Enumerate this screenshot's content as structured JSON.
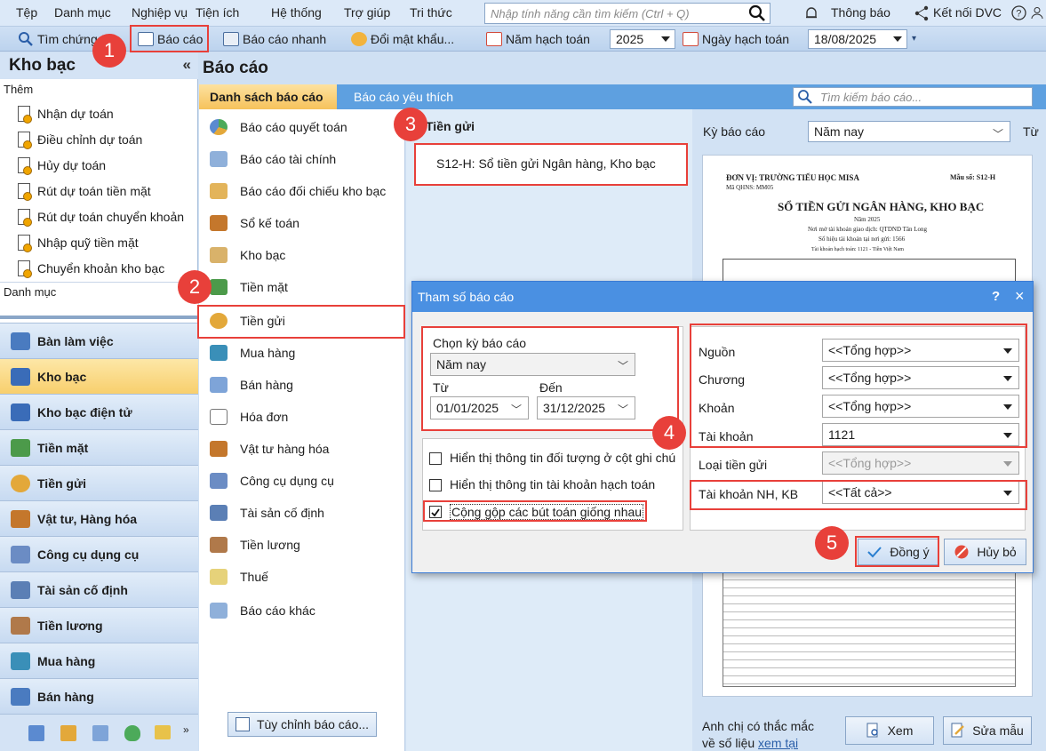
{
  "menubar": {
    "items": [
      "Tệp",
      "Danh mục",
      "Nghiệp vụ",
      "Tiện ích",
      "Hệ thống",
      "Trợ giúp",
      "Tri thức"
    ],
    "search_placeholder": "Nhập tính năng cần tìm kiếm (Ctrl + Q)",
    "notifications": "Thông báo",
    "connect_dvc": "Kết nối DVC"
  },
  "toolbar": {
    "find_voucher": "Tìm chứng từ",
    "report": "Báo cáo",
    "quick_report": "Báo cáo nhanh",
    "change_password": "Đổi mật khẩu...",
    "fiscal_year_label": "Năm hạch toán",
    "fiscal_year": "2025",
    "accounting_date_label": "Ngày hạch toán",
    "accounting_date": "18/08/2025"
  },
  "left": {
    "title": "Kho bạc",
    "add_label": "Thêm",
    "items": [
      "Nhận dự toán",
      "Điều chỉnh dự toán",
      "Hủy dự toán",
      "Rút dự toán tiền mặt",
      "Rút dự toán chuyển khoản",
      "Nhập quỹ tiền mặt",
      "Chuyển khoản kho bạc"
    ],
    "category_label": "Danh mục",
    "nav": [
      "Bàn làm việc",
      "Kho bạc",
      "Kho bạc điện tử",
      "Tiền mặt",
      "Tiền gửi",
      "Vật tư, Hàng hóa",
      "Công cụ dụng cụ",
      "Tài sản cố định",
      "Tiền lương",
      "Mua hàng",
      "Bán hàng"
    ]
  },
  "main": {
    "title": "Báo cáo",
    "tab_list": "Danh sách báo cáo",
    "tab_fav": "Báo cáo yêu thích",
    "search_placeholder": "Tìm kiếm báo cáo...",
    "report_groups": [
      "Báo cáo quyết toán",
      "Báo cáo tài chính",
      "Báo cáo đối chiếu kho bạc",
      "Sổ kế toán",
      "Kho bạc",
      "Tiền mặt",
      "Tiền gửi",
      "Mua hàng",
      "Bán hàng",
      "Hóa đơn",
      "Vật tư hàng hóa",
      "Công cụ dụng cụ",
      "Tài sản cố định",
      "Tiền lương",
      "Thuế",
      "Báo cáo khác"
    ],
    "customize_button": "Tùy chỉnh báo cáo...",
    "group_header": "Tiền gửi",
    "selected_report": "S12-H: Sổ tiền gửi Ngân hàng, Kho bạc",
    "period_label": "Kỳ báo cáo",
    "period_value": "Năm nay",
    "from_label_short": "Từ",
    "help_text_1": "Anh chị có thắc mắc",
    "help_text_2": "về số liệu",
    "help_link": "xem tại",
    "view_button": "Xem",
    "edit_template_button": "Sửa mẫu"
  },
  "preview": {
    "unit": "ĐƠN VỊ: TRƯỜNG TIỂU HỌC MISA",
    "qhns": "Mã QHNS: MM05",
    "form_no": "Mẫu số: S12-H",
    "title": "SỔ TIỀN GỬI NGÂN HÀNG, KHO BẠC",
    "year": "Năm 2025",
    "bank": "Nơi mở tài khoản giao dịch: QTDND Tân Long",
    "account": "Số hiệu tài khoản tại nơi gửi: 1566",
    "ledger": "Tài khoản hạch toán: 1121 - Tiền Việt Nam"
  },
  "dialog": {
    "title": "Tham số báo cáo",
    "help": "?",
    "close": "×",
    "period_label": "Chọn kỳ báo cáo",
    "period_value": "Năm nay",
    "from_label": "Từ",
    "to_label": "Đến",
    "from_date": "01/01/2025",
    "to_date": "31/12/2025",
    "chk1": "Hiển thị thông tin đối tượng ở cột ghi chú",
    "chk2": "Hiển thị thông tin tài khoản hạch toán",
    "chk3": "Cộng gộp các bút toán giống nhau",
    "source_label": "Nguồn",
    "source_value": "<<Tổng hợp>>",
    "chapter_label": "Chương",
    "chapter_value": "<<Tổng hợp>>",
    "section_label": "Khoản",
    "section_value": "<<Tổng hợp>>",
    "account_label": "Tài khoản",
    "account_value": "1121",
    "deposit_type_label": "Loại tiền gửi",
    "deposit_type_value": "<<Tổng hợp>>",
    "bank_account_label": "Tài khoản NH, KB",
    "bank_account_value": "<<Tất cả>>",
    "ok_button": "Đồng ý",
    "cancel_button": "Hủy bỏ"
  },
  "badges": [
    "1",
    "2",
    "3",
    "4",
    "5"
  ],
  "colors": {
    "accent": "#4a90e2",
    "highlight": "#e8403a",
    "tab_active": "#f6c25b"
  }
}
